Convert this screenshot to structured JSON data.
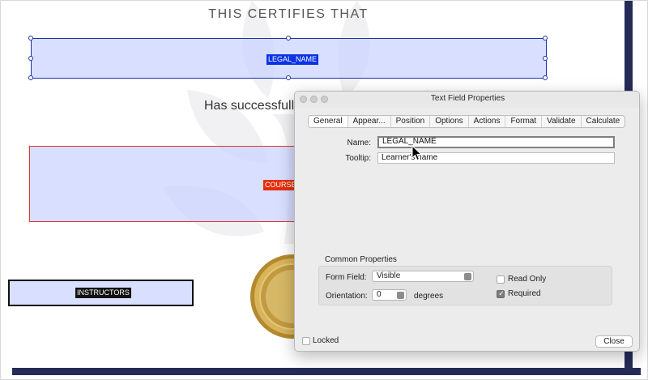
{
  "certificate": {
    "heading": "THIS CERTIFIES THAT",
    "subheading": "Has successfull",
    "fields": {
      "legal_name": "LEGAL_NAME",
      "course": "COURSE",
      "instructors": "INSTRUCTORS"
    }
  },
  "dialog": {
    "title": "Text Field Properties",
    "tabs": [
      "General",
      "Appear...",
      "Position",
      "Options",
      "Actions",
      "Format",
      "Validate",
      "Calculate"
    ],
    "active_tab": "General",
    "name_label": "Name:",
    "name_value": "LEGAL_NAME",
    "tooltip_label": "Tooltip:",
    "tooltip_value": "Learner's name",
    "common_properties": {
      "title": "Common Properties",
      "form_field_label": "Form Field:",
      "form_field_value": "Visible",
      "orientation_label": "Orientation:",
      "orientation_value": "0",
      "orientation_unit": "degrees",
      "read_only_label": "Read Only",
      "read_only_checked": false,
      "required_label": "Required",
      "required_checked": true
    },
    "locked_label": "Locked",
    "locked_checked": false,
    "close_label": "Close"
  },
  "colors": {
    "navy_border": "#242b57",
    "field_fill": "#c9d3ff",
    "legal_name_tag": "#0a32e6",
    "course_tag": "#e62e0a",
    "seal_gold": "#c9a24a"
  },
  "icons": [
    "leaf-watermark",
    "gold-seal",
    "mouse-pointer"
  ]
}
